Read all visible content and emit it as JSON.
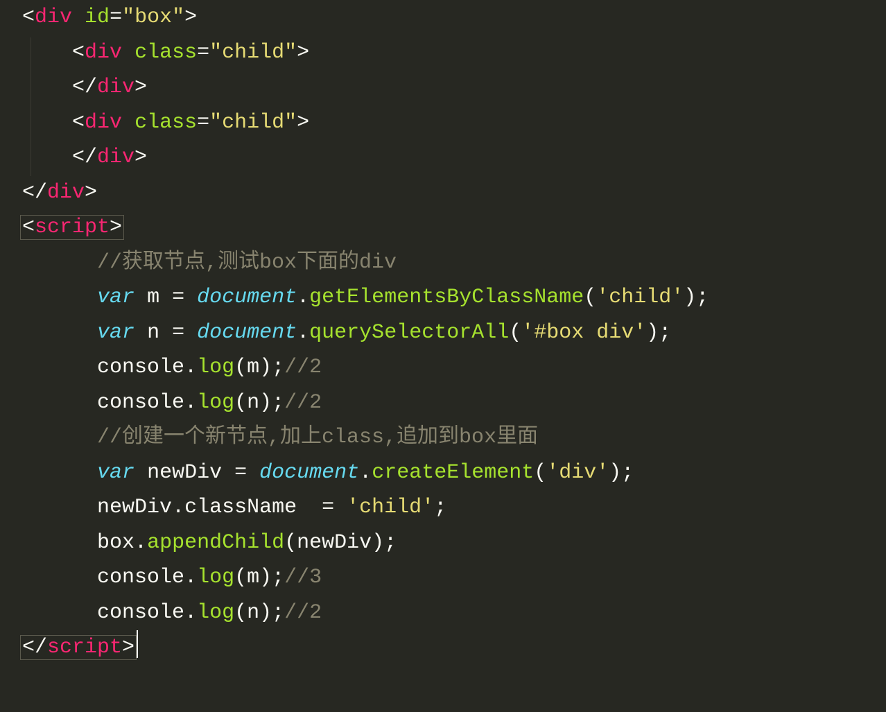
{
  "code": {
    "lines": [
      {
        "indent": 0,
        "kind": "tag-open",
        "tag": "div",
        "attrs": [
          {
            "name": "id",
            "value": "box"
          }
        ]
      },
      {
        "indent": 1,
        "kind": "tag-open",
        "tag": "div",
        "attrs": [
          {
            "name": "class",
            "value": "child"
          }
        ]
      },
      {
        "indent": 1,
        "kind": "tag-close",
        "tag": "div"
      },
      {
        "indent": 1,
        "kind": "tag-open",
        "tag": "div",
        "attrs": [
          {
            "name": "class",
            "value": "child"
          }
        ]
      },
      {
        "indent": 1,
        "kind": "tag-close",
        "tag": "div"
      },
      {
        "indent": 0,
        "kind": "tag-close",
        "tag": "div"
      },
      {
        "indent": 0,
        "kind": "tag-open",
        "tag": "script",
        "boxed": true
      },
      {
        "indent": 1,
        "kind": "comment",
        "text": "//获取节点,测试box下面的div"
      },
      {
        "indent": 1,
        "kind": "decl",
        "varName": "m",
        "obj": "document",
        "method": "getElementsByClassName",
        "arg": "'child'"
      },
      {
        "indent": 1,
        "kind": "decl",
        "varName": "n",
        "obj": "document",
        "method": "querySelectorAll",
        "arg": "'#box div'"
      },
      {
        "indent": 1,
        "kind": "log",
        "arg": "m",
        "trail": "//2"
      },
      {
        "indent": 1,
        "kind": "log",
        "arg": "n",
        "trail": "//2"
      },
      {
        "indent": 1,
        "kind": "comment",
        "text": "//创建一个新节点,加上class,追加到box里面"
      },
      {
        "indent": 1,
        "kind": "decl",
        "varName": "newDiv",
        "obj": "document",
        "method": "createElement",
        "arg": "'div'"
      },
      {
        "indent": 1,
        "kind": "assign",
        "lhsObj": "newDiv",
        "lhsProp": "className",
        "rhs": "'child'",
        "spaceBeforeEq": 2
      },
      {
        "indent": 1,
        "kind": "call",
        "obj": "box",
        "method": "appendChild",
        "arg": "newDiv"
      },
      {
        "indent": 1,
        "kind": "log",
        "arg": "m",
        "trail": "//3"
      },
      {
        "indent": 1,
        "kind": "log",
        "arg": "n",
        "trail": "//2"
      },
      {
        "indent": 0,
        "kind": "tag-close",
        "tag": "script",
        "boxed": true,
        "cursor": true
      }
    ],
    "indentUnit": "    ",
    "extraIndent": "  "
  }
}
